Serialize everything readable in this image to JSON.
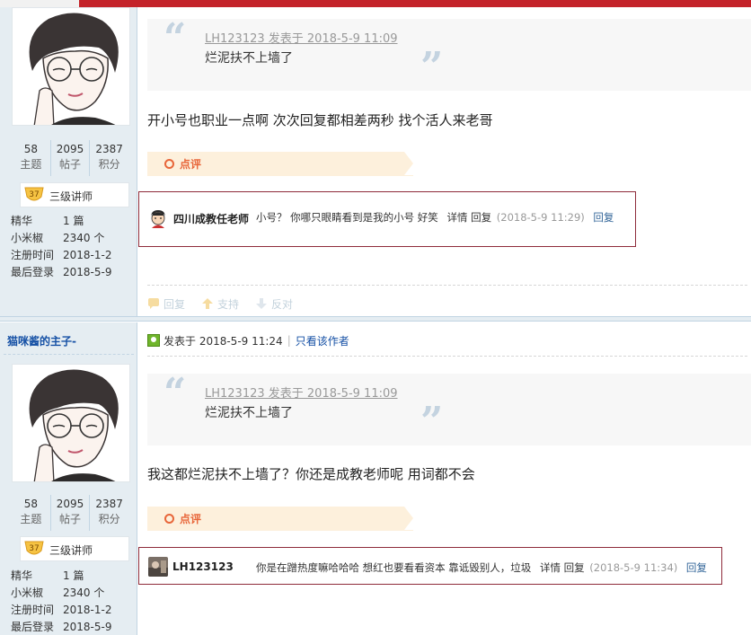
{
  "colors": {
    "accent": "#c4232a",
    "sidebar": "#e5edf2",
    "link": "#1550a5",
    "dianping": "#e8663a",
    "comment_border": "#8e2b3a"
  },
  "posts": [
    {
      "author": "",
      "stats": [
        {
          "num": "58",
          "label": "主题"
        },
        {
          "num": "2095",
          "label": "帖子"
        },
        {
          "num": "2387",
          "label": "积分"
        }
      ],
      "rank_level": "37",
      "rank_title": "三级讲师",
      "info": [
        {
          "k": "精华",
          "v": "1 篇"
        },
        {
          "k": "小米椒",
          "v": "2340 个"
        },
        {
          "k": "注册时间",
          "v": "2018-1-2"
        },
        {
          "k": "最后登录",
          "v": "2018-5-9"
        }
      ],
      "quote_header": "LH123123 发表于 2018-5-9 11:09",
      "quote_body": "烂泥扶不上墙了",
      "content": "开小号也职业一点啊 次次回复都相差两秒 找个活人来老哥",
      "dianping_label": "点评",
      "comment": {
        "name": "四川成教任老师",
        "text": "小号？ 你哪只眼睛看到是我的小号 好笑",
        "detail": "详情",
        "reply_label": "回复",
        "time": "(2018-5-9 11:29)",
        "reply_link": "回复"
      },
      "actions": [
        {
          "icon": "reply-bubble-icon",
          "label": "回复"
        },
        {
          "icon": "thumbs-up-arrow-icon",
          "label": "支持"
        },
        {
          "icon": "thumbs-down-arrow-icon",
          "label": "反对"
        }
      ]
    },
    {
      "author": "猫咪酱的主子-",
      "post_time": "发表于 2018-5-9 11:24",
      "only_author": "只看该作者",
      "stats": [
        {
          "num": "58",
          "label": "主题"
        },
        {
          "num": "2095",
          "label": "帖子"
        },
        {
          "num": "2387",
          "label": "积分"
        }
      ],
      "rank_level": "37",
      "rank_title": "三级讲师",
      "info": [
        {
          "k": "精华",
          "v": "1 篇"
        },
        {
          "k": "小米椒",
          "v": "2340 个"
        },
        {
          "k": "注册时间",
          "v": "2018-1-2"
        },
        {
          "k": "最后登录",
          "v": "2018-5-9"
        }
      ],
      "quote_header": "LH123123 发表于 2018-5-9 11:09",
      "quote_body": "烂泥扶不上墙了",
      "content": "我这都烂泥扶不上墙了？你还是成教老师呢 用词都不会",
      "dianping_label": "点评",
      "comment": {
        "name": "LH123123",
        "text": "你是在蹭热度嘛哈哈哈 想红也要看看资本 靠诋毁别人，垃圾",
        "detail": "详情",
        "reply_label": "回复",
        "time": "(2018-5-9 11:34)",
        "reply_link": "回复"
      }
    }
  ]
}
